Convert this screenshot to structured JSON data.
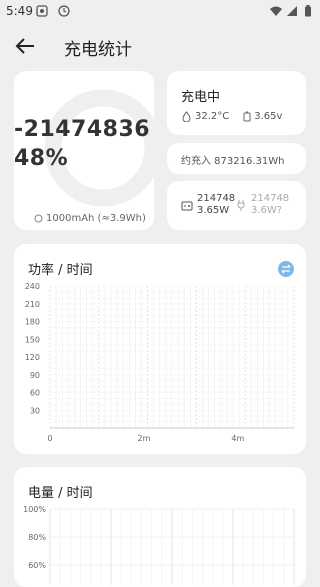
{
  "status_bar": {
    "time": "5:49"
  },
  "app_bar": {
    "title": "充电统计"
  },
  "battery_card": {
    "percent": "-2147483648%",
    "capacity": "1000mAh (≈3.9Wh)"
  },
  "charging_card": {
    "status": "充电中",
    "temperature": "32.2°C",
    "voltage": "3.65v"
  },
  "energy_card": {
    "text": "约充入 873216.31Wh"
  },
  "power_card": {
    "input": "2147483.65W",
    "output": "2147483.6W?"
  },
  "power_chart": {
    "title": "功率 / 时间",
    "y_ticks": [
      "240",
      "210",
      "180",
      "150",
      "120",
      "90",
      "60",
      "30"
    ],
    "x_ticks": [
      "0",
      "2m",
      "4m"
    ]
  },
  "battery_chart": {
    "title": "电量 / 时间",
    "y_ticks": [
      "100%",
      "80%",
      "60%"
    ]
  },
  "chart_data": [
    {
      "type": "line",
      "title": "功率 / 时间",
      "xlabel": "",
      "ylabel": "",
      "ylim": [
        0,
        240
      ],
      "x_ticks": [
        "0",
        "2m",
        "4m"
      ],
      "y_ticks": [
        240,
        210,
        180,
        150,
        120,
        90,
        60,
        30
      ],
      "grid": true,
      "series": []
    },
    {
      "type": "line",
      "title": "电量 / 时间",
      "xlabel": "",
      "ylabel": "",
      "ylim": [
        60,
        100
      ],
      "y_ticks": [
        "100%",
        "80%",
        "60%"
      ],
      "grid": true,
      "series": []
    }
  ]
}
